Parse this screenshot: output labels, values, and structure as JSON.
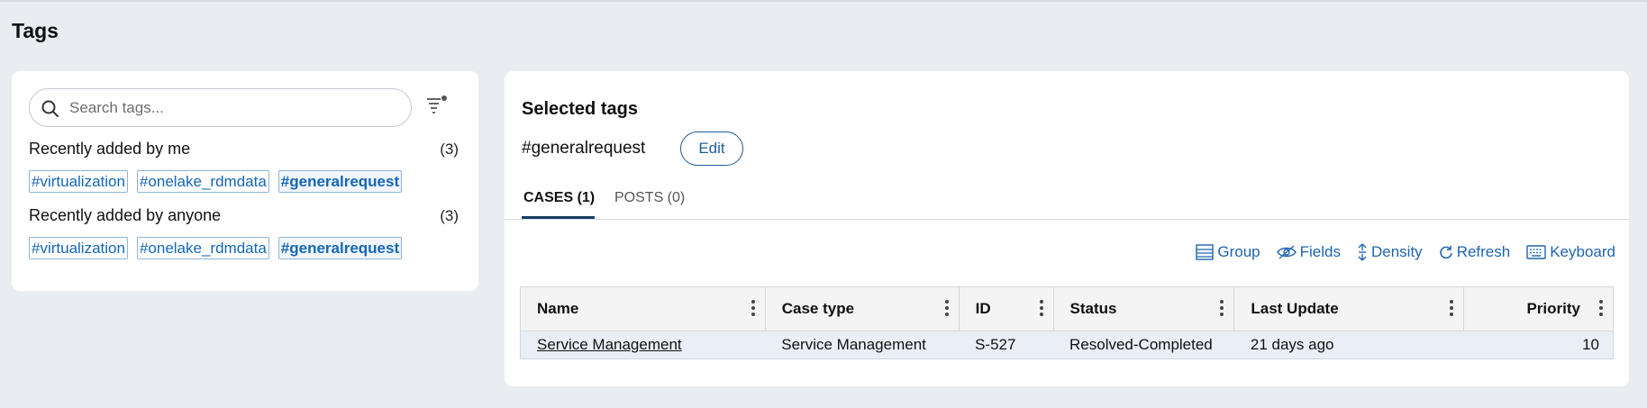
{
  "page": {
    "title": "Tags"
  },
  "left": {
    "search": {
      "placeholder": "Search tags..."
    },
    "sections": [
      {
        "label": "Recently added by me",
        "count": "(3)",
        "tags": [
          "#virtualization",
          "#onelake_rdmdata",
          "#generalrequest"
        ]
      },
      {
        "label": "Recently added by anyone",
        "count": "(3)",
        "tags": [
          "#virtualization",
          "#onelake_rdmdata",
          "#generalrequest"
        ]
      }
    ]
  },
  "right": {
    "title": "Selected tags",
    "selected_tag": "#generalrequest",
    "edit_label": "Edit",
    "tabs": [
      {
        "label": "CASES (1)",
        "active": true
      },
      {
        "label": "POSTS (0)",
        "active": false
      }
    ],
    "toolbar": {
      "group": "Group",
      "fields": "Fields",
      "density": "Density",
      "refresh": "Refresh",
      "keyboard": "Keyboard"
    },
    "table": {
      "headers": [
        "Name",
        "Case type",
        "ID",
        "Status",
        "Last Update",
        "Priority"
      ],
      "rows": [
        [
          "Service Management",
          "Service Management",
          "S-527",
          "Resolved-Completed",
          "21 days ago",
          "10"
        ]
      ]
    }
  },
  "colors": {
    "background": "#e9edf1",
    "link": "#1f64b0",
    "chip_border": "#8fb4d9",
    "tab_underline": "#1b3f63"
  },
  "icons": [
    "search-icon",
    "filter-icon",
    "group-icon",
    "fields-icon",
    "density-icon",
    "refresh-icon",
    "keyboard-icon",
    "kebab-icon"
  ]
}
